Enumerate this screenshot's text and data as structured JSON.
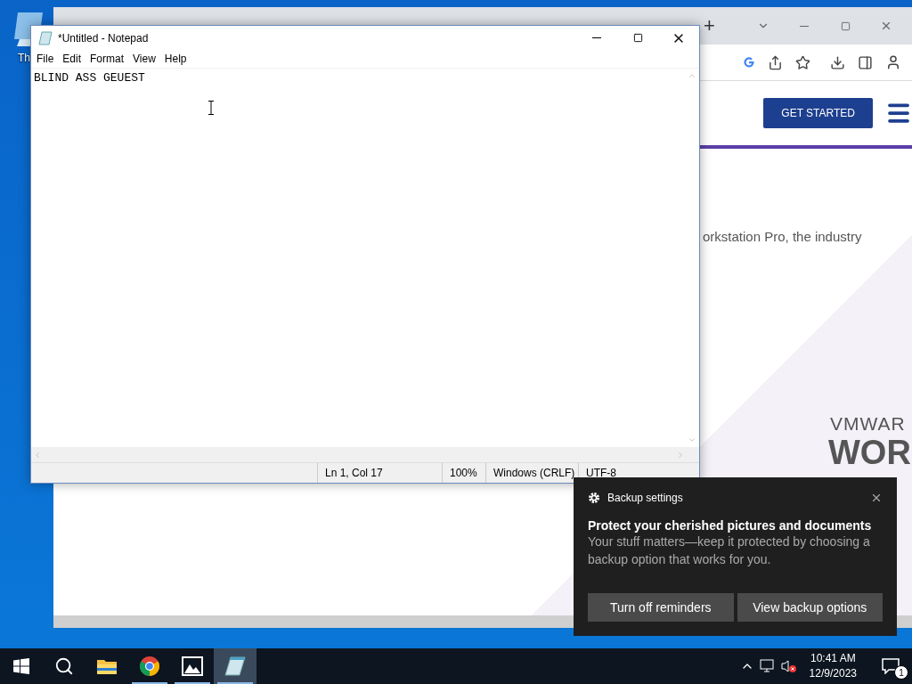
{
  "desktop": {
    "icon_label": "Th"
  },
  "browser": {
    "new_tab": "+",
    "cta": "GET STARTED",
    "hero_text": "orkstation Pro, the industry",
    "brand_line": "VMWAR",
    "brand_title": "WOR"
  },
  "notepad": {
    "title": "*Untitled - Notepad",
    "menu": [
      "File",
      "Edit",
      "Format",
      "View",
      "Help"
    ],
    "content": "BLIND ASS GEUEST",
    "status": [
      "Ln 1, Col 17",
      "100%",
      "Windows (CRLF)",
      "UTF-8"
    ]
  },
  "notification": {
    "app": "Backup settings",
    "title": "Protect your cherished pictures and documents",
    "body": "Your stuff matters—keep it protected by choosing a backup option that works for you.",
    "buttons": [
      "Turn off reminders",
      "View backup options"
    ]
  },
  "taskbar": {
    "apps": [
      {
        "kind": "explorer",
        "running": false,
        "selected": false
      },
      {
        "kind": "chrome",
        "running": true,
        "selected": false
      },
      {
        "kind": "photos",
        "running": true,
        "selected": false
      },
      {
        "kind": "notepad",
        "running": true,
        "selected": true
      }
    ],
    "time": "10:41 AM",
    "date": "12/9/2023",
    "notification_count": "1"
  }
}
